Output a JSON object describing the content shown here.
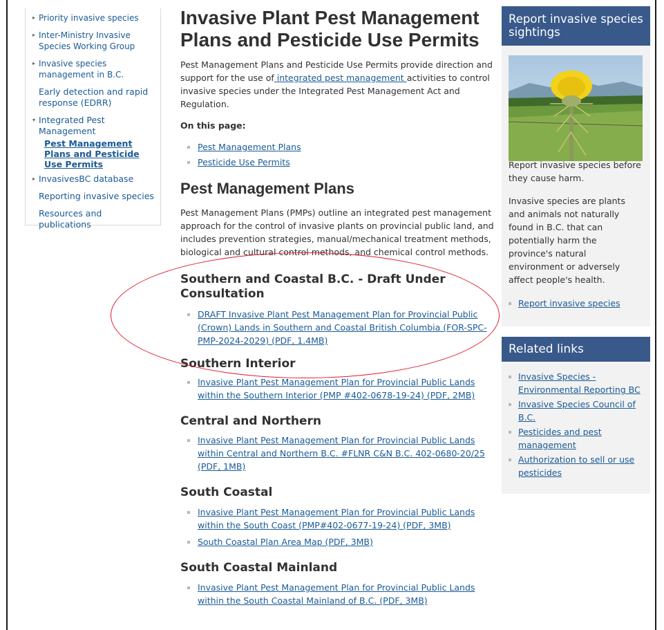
{
  "leftnav": {
    "items": [
      {
        "label": "Priority invasive species"
      },
      {
        "label": "Inter-Ministry Invasive Species Working Group"
      },
      {
        "label": "Invasive species management in B.C."
      },
      {
        "label": "Early detection and rapid response (EDRR)"
      },
      {
        "label": "Integrated Pest Management"
      },
      {
        "label": "Pest Management Plans and Pesticide Use Permits"
      },
      {
        "label": "InvasivesBC database"
      },
      {
        "label": "Reporting invasive species"
      },
      {
        "label": "Resources and publications"
      }
    ]
  },
  "main": {
    "title": "Invasive Plant Pest Management Plans and Pesticide Use Permits",
    "intro_before": "Pest Management Plans and Pesticide Use Permits provide direction and support for the use of",
    "intro_link": " integrated pest management ",
    "intro_after": "activities to control invasive species under the Integrated Pest Management Act and Regulation.",
    "on_this_page": "On this page:",
    "toc": [
      "Pest Management Plans",
      "Pesticide Use Permits"
    ],
    "pmp_heading": "Pest Management Plans",
    "pmp_text": "Pest Management Plans (PMPs) outline an integrated pest management approach for the control of invasive plants on provincial public land, and includes prevention strategies, manual/mechanical treatment methods, biological and cultural control methods, and chemical control methods.",
    "sections": [
      {
        "heading": "Southern and Coastal B.C. - Draft Under Consultation",
        "links": [
          "DRAFT Invasive Plant Pest Management Plan for Provincial Public (Crown) Lands in Southern and Coastal British Columbia (FOR-SPC-PMP-2024-2029) (PDF, 1.4MB)"
        ]
      },
      {
        "heading": "Southern Interior",
        "links": [
          "Invasive Plant Pest Management Plan for Provincial Public Lands within the Southern Interior (PMP #402-0678-19-24) (PDF, 2MB)"
        ]
      },
      {
        "heading": "Central and Northern",
        "links": [
          "Invasive Plant Pest Management Plan for Provincial Public Lands within Central and Northern B.C. #FLNR C&N B.C. 402-0680-20/25 (PDF, 1MB)"
        ]
      },
      {
        "heading": "South Coastal",
        "links": [
          "Invasive Plant Pest Management Plan for Provincial Public Lands within the South Coast (PMP#402-0677-19-24) (PDF, 3MB)",
          "South Coastal Plan Area Map (PDF, 3MB)"
        ]
      },
      {
        "heading": "South Coastal Mainland",
        "links": [
          "Invasive Plant Pest Management Plan for Provincial Public Lands within the South Coastal Mainland of B.C. (PDF, 3MB)"
        ]
      }
    ]
  },
  "sidebar": {
    "report": {
      "title": "Report invasive species sightings",
      "p1": "Report invasive species before they cause harm.",
      "p2": "Invasive species are plants and animals not naturally found in B.C. that can potentially harm the province's natural environment or adversely affect people's health.",
      "link": "Report invasive species"
    },
    "related": {
      "title": "Related links",
      "links": [
        "Invasive Species - Environmental Reporting BC",
        "Invasive Species Council of B.C.",
        "Pesticides and pest management",
        "Authorization to sell or use pesticides"
      ]
    }
  },
  "colors": {
    "accent": "#38598a",
    "link": "#1a5a96",
    "annotation": "#e0192a"
  }
}
